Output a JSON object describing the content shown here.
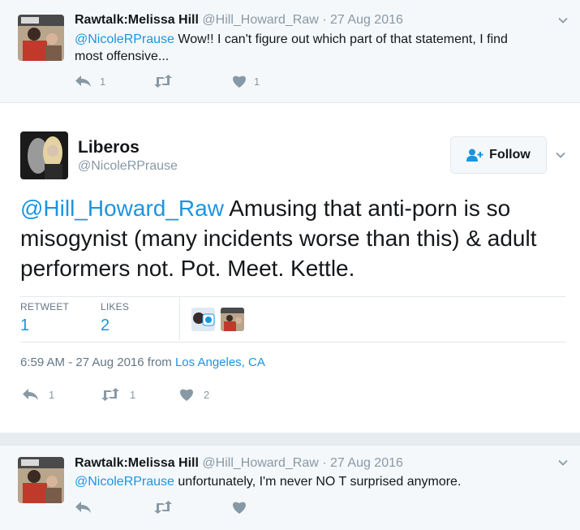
{
  "reply_top": {
    "name": "Rawtalk:Melissa Hill",
    "handle": "@Hill_Howard_Raw",
    "date": "27 Aug 2016",
    "mention": "@NicoleRPrause",
    "text_line1": " Wow!! I can't figure out which part of that statement, I find",
    "text_line2": "most offensive...",
    "reply_count": "1",
    "retweet_count": "",
    "like_count": "1"
  },
  "main_tweet": {
    "name": "Liberos",
    "handle": "@NicoleRPrause",
    "follow_label": "Follow",
    "mention": "@Hill_Howard_Raw",
    "text": " Amusing that anti-porn is so misogynist (many incidents worse than this) & adult performers not. Pot. Meet. Kettle.",
    "retweets_label": "RETWEET",
    "retweets_value": "1",
    "likes_label": "LIKES",
    "likes_value": "2",
    "timestamp": "6:59 AM - 27 Aug 2016 from ",
    "location": "Los Angeles, CA",
    "reply_count": "1",
    "retweet_count": "1",
    "like_count": "2"
  },
  "reply_bottom": {
    "name": "Rawtalk:Melissa Hill",
    "handle": "@Hill_Howard_Raw",
    "date": "27 Aug 2016",
    "mention": "@NicoleRPrause",
    "text": " unfortunately, I'm never  NO T surprised  anymore."
  },
  "colors": {
    "link": "#1b95e0",
    "muted": "#8899a6",
    "reply_bg": "#f5f8fa"
  },
  "icons": [
    "reply-icon",
    "retweet-icon",
    "heart-icon",
    "chevron-down-icon",
    "follow-user-icon"
  ]
}
